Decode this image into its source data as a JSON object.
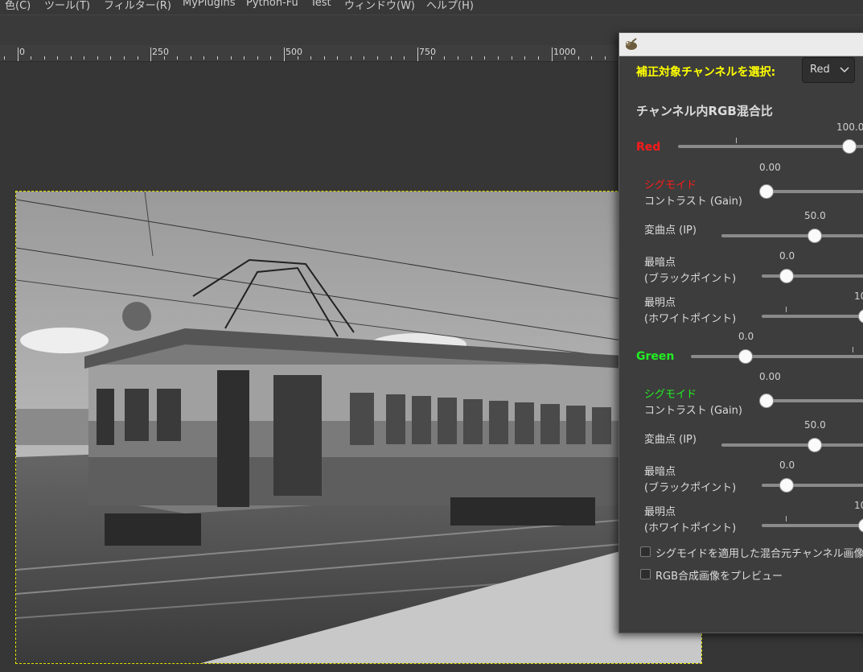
{
  "menubar": {
    "items": [
      "色(C)",
      "ツール(T)",
      "フィルター(R)",
      "MyPlugins",
      "Python-Fu",
      "Test",
      "ウィンドウ(W)",
      "ヘルプ(H)"
    ]
  },
  "ruler": {
    "labels": [
      "0",
      "250",
      "500",
      "750",
      "1000"
    ]
  },
  "dialog": {
    "channel_select_label": "補正対象チャンネルを選択:",
    "channel_select_value": "Red",
    "section_title": "チャンネル内RGB混合比",
    "red": {
      "label": "Red",
      "value": "100.0",
      "sigmoid_label": "シグモイド",
      "gain_label": "コントラスト (Gain)",
      "gain_value": "0.00",
      "ip_label": "変曲点 (IP)",
      "ip_value": "50.0",
      "black_label_1": "最暗点",
      "black_label_2": "(ブラックポイント)",
      "black_value": "0.0",
      "white_label_1": "最明点",
      "white_label_2": "(ホワイトポイント)",
      "white_value": "10"
    },
    "green": {
      "label": "Green",
      "value": "0.0",
      "sigmoid_label": "シグモイド",
      "gain_label": "コントラスト (Gain)",
      "gain_value": "0.00",
      "ip_label": "変曲点 (IP)",
      "ip_value": "50.0",
      "black_label_1": "最暗点",
      "black_label_2": "(ブラックポイント)",
      "black_value": "0.0",
      "white_label_1": "最明点",
      "white_label_2": "(ホワイトポイント)",
      "white_value": "10"
    },
    "checkbox_1_label": "シグモイドを適用した混合元チャンネル画像",
    "checkbox_2_label": "RGB合成画像をプレビュー",
    "colors": {
      "title_yellow": "#ffff00",
      "red": "#ff1a1a",
      "green": "#22ee22"
    }
  }
}
